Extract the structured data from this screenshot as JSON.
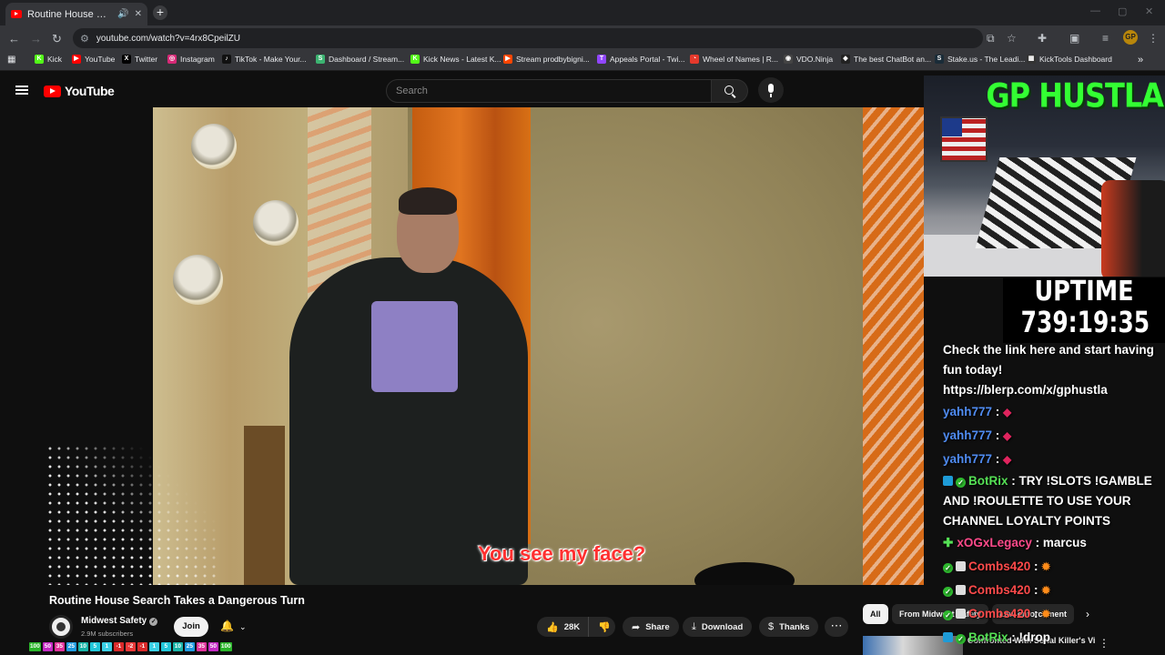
{
  "browser": {
    "tab_title": "Routine House Search Takes a Dangerous Turn",
    "url": "youtube.com/watch?v=4rx8CpeilZU",
    "bookmarks": [
      {
        "label": "Kick",
        "color": "#53fc18",
        "glyph": "K"
      },
      {
        "label": "YouTube",
        "color": "#ff0000",
        "glyph": "▶"
      },
      {
        "label": "Twitter",
        "color": "#000000",
        "glyph": "X"
      },
      {
        "label": "Instagram",
        "color": "#d62976",
        "glyph": "◎"
      },
      {
        "label": "TikTok - Make Your...",
        "color": "#111111",
        "glyph": "♪"
      },
      {
        "label": "Dashboard / Stream...",
        "color": "#3cb371",
        "glyph": "S"
      },
      {
        "label": "Kick News - Latest K...",
        "color": "#53fc18",
        "glyph": "K"
      },
      {
        "label": "Stream prodbybigni...",
        "color": "#ff4500",
        "glyph": "▶"
      },
      {
        "label": "Appeals Portal - Twi...",
        "color": "#9146ff",
        "glyph": "T"
      },
      {
        "label": "Wheel of Names | R...",
        "color": "#e5392c",
        "glyph": "◔"
      },
      {
        "label": "VDO.Ninja",
        "color": "#444444",
        "glyph": "◉"
      },
      {
        "label": "The best ChatBot an...",
        "color": "#222222",
        "glyph": "◆"
      },
      {
        "label": "Stake.us - The Leadi...",
        "color": "#1a2c38",
        "glyph": "S"
      },
      {
        "label": "KickTools Dashboard",
        "color": "#333333",
        "glyph": "▦"
      }
    ]
  },
  "youtube": {
    "logo_text": "YouTube",
    "search_placeholder": "Search",
    "caption": "You see my face?",
    "video_title": "Routine House Search Takes a Dangerous Turn",
    "channel_name": "Midwest Safety",
    "subscribers": "2.9M subscribers",
    "join_label": "Join",
    "like_count": "28K",
    "share_label": "Share",
    "download_label": "Download",
    "thanks_label": "Thanks",
    "chips": [
      "All",
      "From Midwest Safety",
      "Law enforcement"
    ],
    "rec_title": "Confronted With Serial Killer's Victims"
  },
  "stream_overlay": {
    "cam_title": "GP HUSTLA",
    "uptime_label": "UPTIME",
    "uptime_value": "739:19:35",
    "promo_text": "Check the link here and start having fun today!",
    "promo_link": "https://blerp.com/x/gphustla",
    "chat": [
      {
        "user": "yahh777",
        "text": "",
        "color": "blue",
        "emote": "gem",
        "badge": ""
      },
      {
        "user": "yahh777",
        "text": "",
        "color": "blue",
        "emote": "gem",
        "badge": ""
      },
      {
        "user": "yahh777",
        "text": "",
        "color": "blue",
        "emote": "gem",
        "badge": ""
      },
      {
        "user": "BotRix",
        "text": "TRY !SLOTS !GAMBLE AND !ROULETTE TO USE YOUR CHANNEL LOYALTY POINTS",
        "color": "green",
        "emote": "",
        "badge": "bot"
      },
      {
        "user": "xOGxLegacy",
        "text": "marcus",
        "color": "pink",
        "emote": "",
        "badge": "plus"
      },
      {
        "user": "Combs420",
        "text": "",
        "color": "red",
        "emote": "fire",
        "badge": "mod"
      },
      {
        "user": "Combs420",
        "text": "",
        "color": "red",
        "emote": "fire",
        "badge": "mod"
      },
      {
        "user": "Combs420",
        "text": "",
        "color": "red",
        "emote": "fire",
        "badge": "mod"
      },
      {
        "user": "BotRix",
        "text": "!drop",
        "color": "green",
        "emote": "",
        "badge": "bot"
      }
    ],
    "sub_badges": [
      {
        "label": "100",
        "color": "#2bb52b"
      },
      {
        "label": "50",
        "color": "#c42bc4"
      },
      {
        "label": "35",
        "color": "#e0329a"
      },
      {
        "label": "25",
        "color": "#1f9be0"
      },
      {
        "label": "10",
        "color": "#19b5a8"
      },
      {
        "label": "5",
        "color": "#21c7d9"
      },
      {
        "label": "1",
        "color": "#3ad1e6"
      },
      {
        "label": "-1",
        "color": "#d92a2a"
      },
      {
        "label": "-2",
        "color": "#e83838"
      },
      {
        "label": "-1",
        "color": "#d92a2a"
      },
      {
        "label": "1",
        "color": "#3ad1e6"
      },
      {
        "label": "5",
        "color": "#21c7d9"
      },
      {
        "label": "10",
        "color": "#19b5a8"
      },
      {
        "label": "25",
        "color": "#1f9be0"
      },
      {
        "label": "35",
        "color": "#e0329a"
      },
      {
        "label": "50",
        "color": "#c42bc4"
      },
      {
        "label": "100",
        "color": "#2bb52b"
      }
    ]
  }
}
